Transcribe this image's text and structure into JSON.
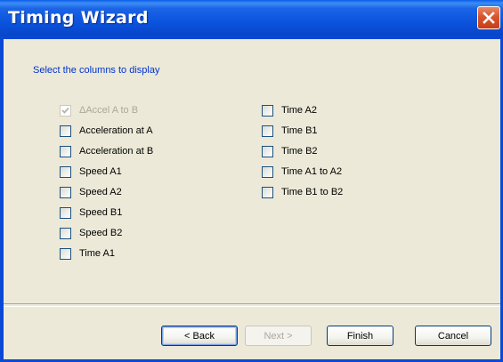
{
  "window": {
    "title": "Timing Wizard"
  },
  "instruction": "Select the columns to display",
  "columns_left": [
    {
      "label": "ΔAccel A to B",
      "checked": true,
      "disabled": true
    },
    {
      "label": "Acceleration at A",
      "checked": false,
      "disabled": false
    },
    {
      "label": "Acceleration at B",
      "checked": false,
      "disabled": false
    },
    {
      "label": "Speed A1",
      "checked": false,
      "disabled": false
    },
    {
      "label": "Speed A2",
      "checked": false,
      "disabled": false
    },
    {
      "label": "Speed B1",
      "checked": false,
      "disabled": false
    },
    {
      "label": "Speed B2",
      "checked": false,
      "disabled": false
    },
    {
      "label": "Time A1",
      "checked": false,
      "disabled": false
    }
  ],
  "columns_right": [
    {
      "label": "Time A2",
      "checked": false,
      "disabled": false
    },
    {
      "label": "Time B1",
      "checked": false,
      "disabled": false
    },
    {
      "label": "Time B2",
      "checked": false,
      "disabled": false
    },
    {
      "label": "Time A1 to A2",
      "checked": false,
      "disabled": false
    },
    {
      "label": "Time B1 to B2",
      "checked": false,
      "disabled": false
    }
  ],
  "buttons": {
    "back": "< Back",
    "next": "Next >",
    "finish": "Finish",
    "cancel": "Cancel"
  },
  "colors": {
    "titlebar": "#0a52dc",
    "instruction_text": "#0033cc",
    "close_button": "#d9542c",
    "dialog_background": "#ece9d8"
  }
}
